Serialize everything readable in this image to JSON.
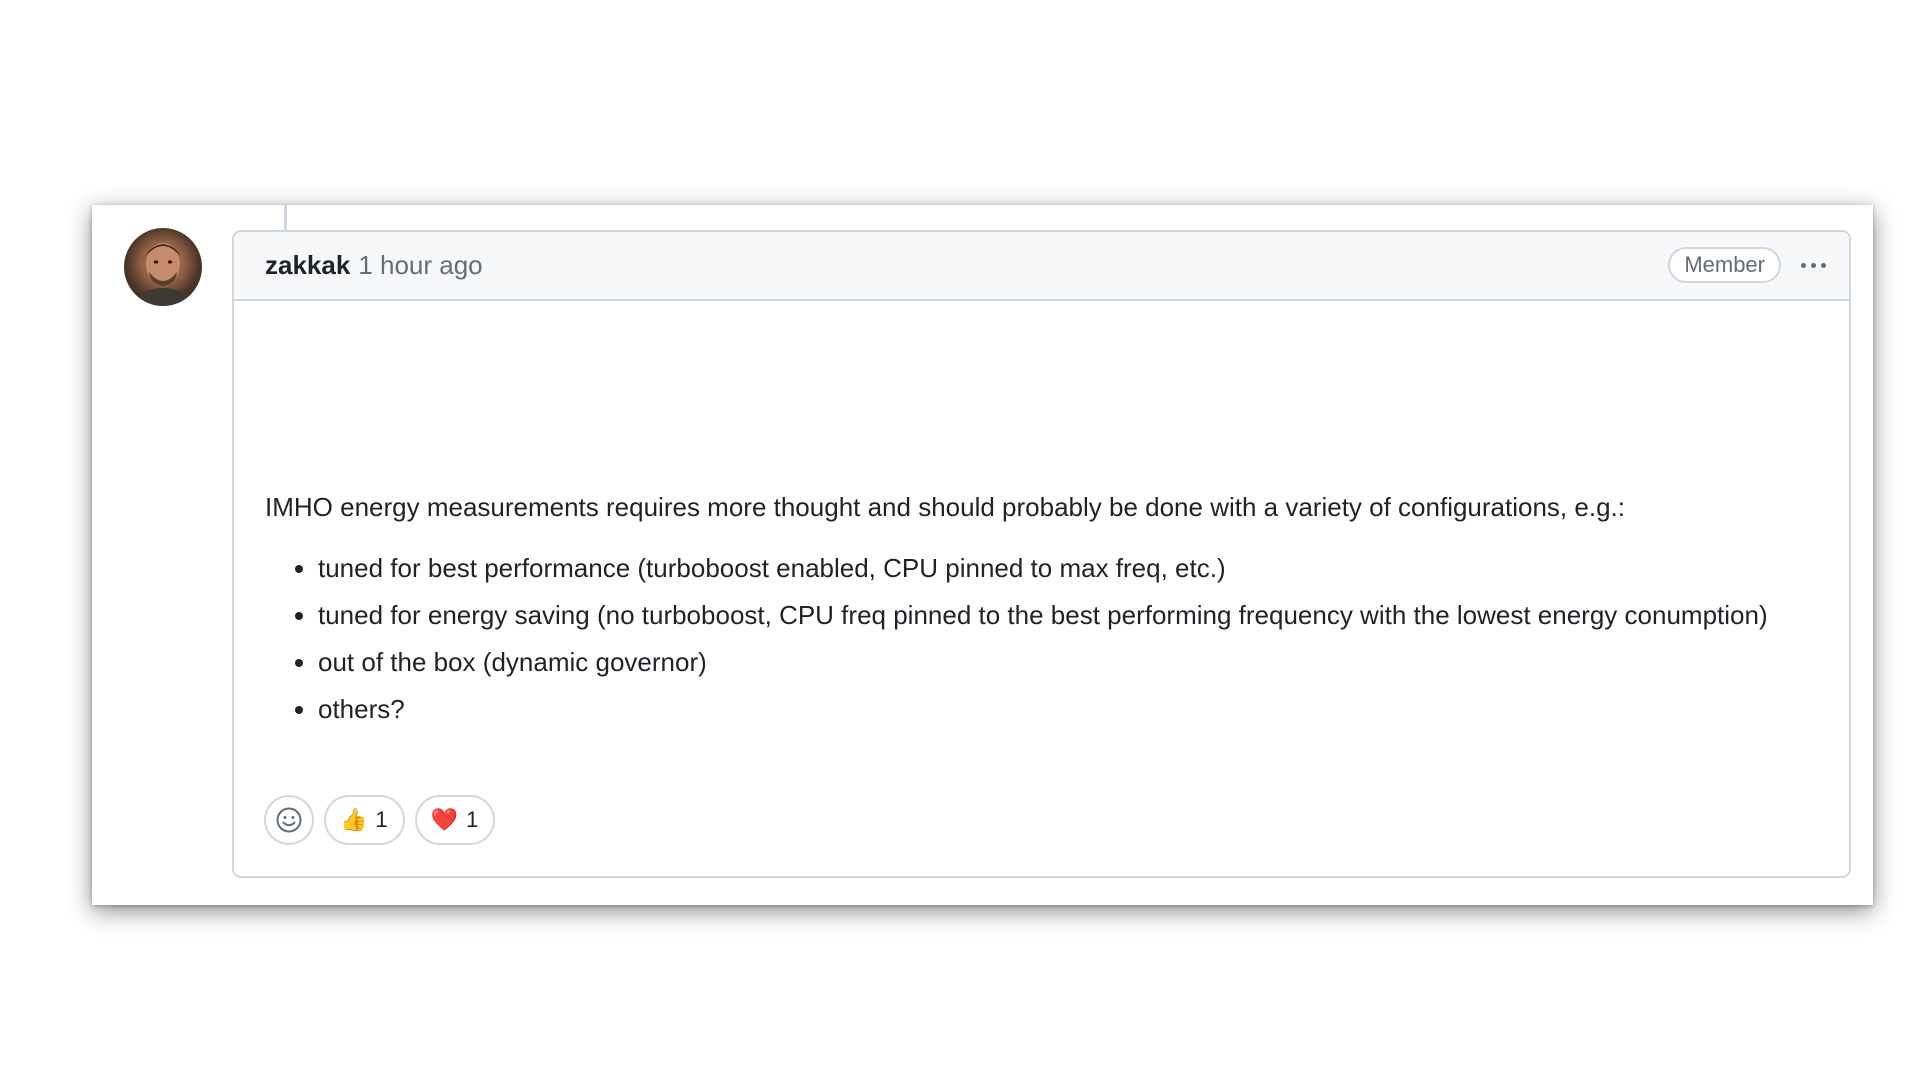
{
  "comment": {
    "author": "zakkak",
    "time": "1 hour ago",
    "role_badge": "Member",
    "more_label": "···",
    "body": {
      "intro": "IMHO energy measurements requires more thought and should probably be done with a variety of configurations, e.g.:",
      "items": [
        "tuned for best performance (turboboost enabled, CPU pinned to max freq, etc.)",
        "tuned for energy saving (no turboboost, CPU freq pinned to the best performing frequency with the lowest energy conumption)",
        "out of the box (dynamic governor)",
        "others?"
      ]
    },
    "reactions": [
      {
        "emoji": "👍",
        "icon": "thumbs-up-icon",
        "count": "1"
      },
      {
        "emoji": "❤️",
        "icon": "heart-icon",
        "count": "1"
      }
    ]
  },
  "colors": {
    "border": "#d0d7de",
    "header_bg": "#f6f8fa",
    "text": "#1f2328",
    "muted": "#656d76"
  }
}
